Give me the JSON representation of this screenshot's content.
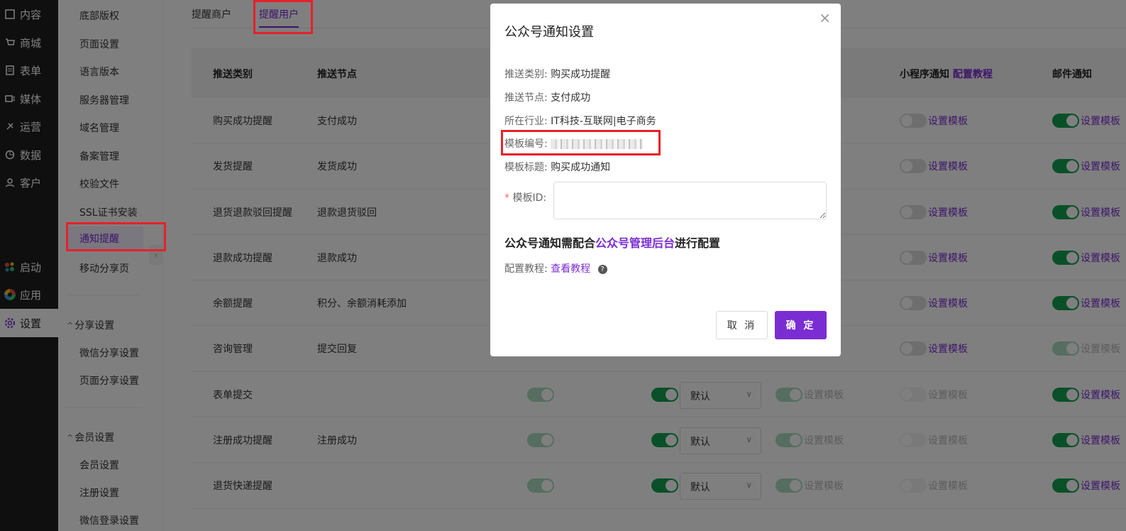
{
  "nav": {
    "items": [
      {
        "label": "内容",
        "icon": "content-icon"
      },
      {
        "label": "商城",
        "icon": "cart-icon"
      },
      {
        "label": "表单",
        "icon": "form-icon"
      },
      {
        "label": "媒体",
        "icon": "media-icon"
      },
      {
        "label": "运营",
        "icon": "pin-icon"
      },
      {
        "label": "数据",
        "icon": "pie-icon"
      },
      {
        "label": "客户",
        "icon": "user-icon"
      },
      {
        "label": "启动",
        "icon": "launch-icon"
      },
      {
        "label": "应用",
        "icon": "apps-icon"
      },
      {
        "label": "设置",
        "icon": "gear-icon"
      }
    ]
  },
  "submenu": {
    "items": [
      "底部版权",
      "页面设置",
      "语言版本",
      "服务器管理",
      "域名管理",
      "备案管理",
      "校验文件",
      "SSL证书安装",
      "通知提醒",
      "移动分享页"
    ],
    "group_share": "分享设置",
    "share_items": [
      "微信分享设置",
      "页面分享设置"
    ],
    "group_member": "会员设置",
    "member_items": [
      "会员设置",
      "注册设置",
      "微信登录设置"
    ]
  },
  "tabs": [
    "提醒商户",
    "提醒用户"
  ],
  "table": {
    "headers": {
      "type": "推送类别",
      "node": "推送节点",
      "mini": "小程序通知",
      "mini_link": "配置教程",
      "mail": "邮件通知"
    },
    "template_link": "设置模板",
    "select_default": "默认",
    "rows": [
      {
        "type": "购买成功提醒",
        "node": "支付成功"
      },
      {
        "type": "发货提醒",
        "node": "发货成功"
      },
      {
        "type": "退货退款驳回提醒",
        "node": "退款退货驳回"
      },
      {
        "type": "退款成功提醒",
        "node": "退款成功"
      },
      {
        "type": "余额提醒",
        "node": "积分、余额消耗添加"
      },
      {
        "type": "咨询管理",
        "node": "提交回复"
      },
      {
        "type": "表单提交",
        "node": ""
      },
      {
        "type": "注册成功提醒",
        "node": "注册成功"
      },
      {
        "type": "退货快递提醒",
        "node": ""
      }
    ]
  },
  "dialog": {
    "title": "公众号通知设置",
    "push_type_label": "推送类别:",
    "push_type": "购买成功提醒",
    "push_node_label": "推送节点:",
    "push_node": "支付成功",
    "industry_label": "所在行业:",
    "industry": "IT科技-互联网|电子商务",
    "template_no_label": "模板编号:",
    "template_title_label": "模板标题:",
    "template_title": "购买成功通知",
    "template_id_label": "模板ID:",
    "note_prefix": "公众号通知需配合",
    "note_link": "公众号管理后台",
    "note_suffix": "进行配置",
    "tutorial_label": "配置教程:",
    "tutorial_link": "查看教程",
    "cancel": "取 消",
    "ok": "确 定"
  },
  "colors": {
    "accent": "#7a2dd3",
    "switch_on": "#12a150",
    "annotation": "#e5212b"
  }
}
